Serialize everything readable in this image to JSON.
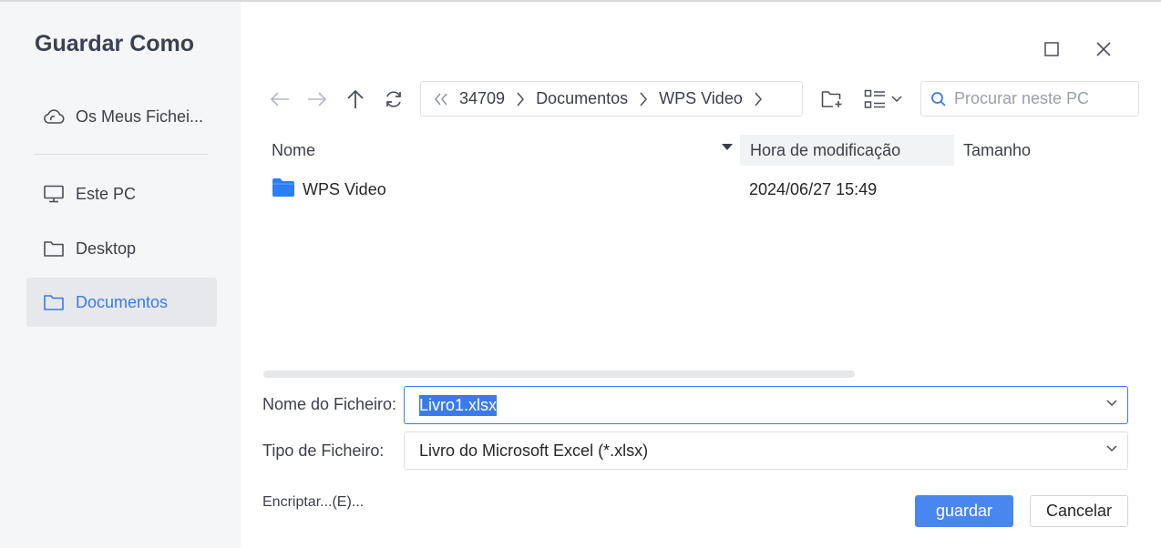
{
  "dialog": {
    "title": "Guardar Como"
  },
  "sidebar": {
    "items": [
      {
        "label": "Os Meus Fichei...",
        "icon": "cloud-icon"
      },
      {
        "label": "Este PC",
        "icon": "monitor-icon"
      },
      {
        "label": "Desktop",
        "icon": "folder-icon"
      },
      {
        "label": "Documentos",
        "icon": "folder-icon",
        "active": true
      }
    ]
  },
  "breadcrumb": {
    "items": [
      "34709",
      "Documentos",
      "WPS Video"
    ]
  },
  "search": {
    "placeholder": "Procurar neste PC"
  },
  "columns": {
    "name": "Nome",
    "modified": "Hora de modificação",
    "size": "Tamanho"
  },
  "files": [
    {
      "name": "WPS Video",
      "modified": "2024/06/27 15:49",
      "type": "folder"
    }
  ],
  "form": {
    "filename_label": "Nome do Ficheiro:",
    "filename_value": "Livro1.xlsx",
    "filetype_label": "Tipo de Ficheiro:",
    "filetype_value": "Livro do Microsoft Excel (*.xlsx)"
  },
  "actions": {
    "encrypt": "Encriptar...(E)...",
    "save": "guardar",
    "cancel": "Cancelar"
  },
  "colors": {
    "accent": "#4a86f0",
    "active_text": "#3a7bea",
    "folder": "#2b7ef5"
  }
}
